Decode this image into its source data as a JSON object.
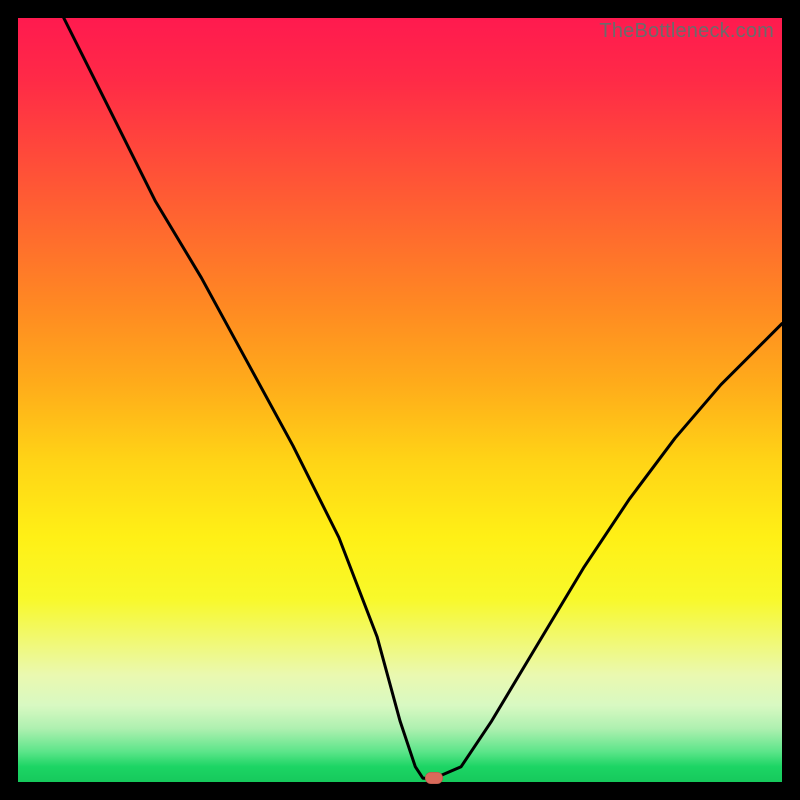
{
  "watermark": "TheBottleneck.com",
  "chart_data": {
    "type": "line",
    "title": "",
    "xlabel": "",
    "ylabel": "",
    "xlim": [
      0,
      100
    ],
    "ylim": [
      0,
      100
    ],
    "grid": false,
    "series": [
      {
        "name": "bottleneck-curve",
        "x": [
          6,
          12,
          18,
          24,
          30,
          36,
          42,
          47,
          50,
          52,
          53,
          54.5,
          58,
          62,
          68,
          74,
          80,
          86,
          92,
          98,
          100
        ],
        "y": [
          100,
          88,
          76,
          66,
          55,
          44,
          32,
          19,
          8,
          2,
          0.5,
          0.5,
          2,
          8,
          18,
          28,
          37,
          45,
          52,
          58,
          60
        ]
      }
    ],
    "marker": {
      "x": 54.5,
      "y": 0.5,
      "color": "#d96a5a"
    },
    "gradient_stops": [
      {
        "pos": 0,
        "color": "#ff1a4f"
      },
      {
        "pos": 50,
        "color": "#ffd416"
      },
      {
        "pos": 100,
        "color": "#16c95c"
      }
    ]
  }
}
